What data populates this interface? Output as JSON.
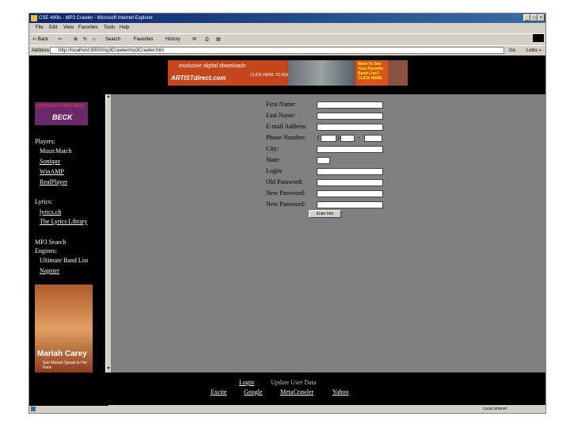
{
  "window": {
    "title": "CSE 490ls - MP3 Crawler - Microsoft Internet Explorer",
    "controls": [
      "_",
      "□",
      "×"
    ]
  },
  "menu": [
    "File",
    "Edit",
    "View",
    "Favorites",
    "Tools",
    "Help"
  ],
  "toolbar": {
    "back": "⇦ Back",
    "forward": "⇨",
    "search": "Search",
    "favorites": "Favorites",
    "history": "History"
  },
  "address": {
    "label": "Address",
    "url": "http://localhost:8000/mp3Crawler/mp3Crawler.htm",
    "go": "Go",
    "links": "Links »"
  },
  "banner": {
    "tagline": "exclusive digital downloads",
    "brand": "ARTISTdirect.com",
    "click": "CLICK HERE TO ROCK",
    "promo": "Want To See Your Favorite Band Live? CLICK HERE"
  },
  "sidebar": {
    "ad_header": "ENTANGLED FANS WEEK",
    "ad_title": "BECK",
    "players_heading": "Players:",
    "players": [
      "MusicMatch",
      "Sonique",
      "WinAMP",
      "RealPlayer"
    ],
    "lyrics_heading": "Lyrics:",
    "lyrics": [
      "lyrics.ch",
      "The Lyrics Library"
    ],
    "search_heading_1": "MP3 Search",
    "search_heading_2": "Engines:",
    "engines": [
      "Ultimate Band List",
      "Napster"
    ],
    "ad2_name": "Mariah Carey",
    "ad2_sub": "See Mariah Speak to Her Fans"
  },
  "form": {
    "first_name": "First Name:",
    "last_name": "Last Name:",
    "email": "E-mail Address:",
    "phone": "Phone Number:",
    "phone_open": "(",
    "phone_close": ")",
    "phone_dash": "-",
    "city": "City:",
    "state": "State:",
    "login": "Login:",
    "old_password": "Old Password:",
    "new_password": "New Password:",
    "new_password2": "New Password:",
    "submit": "Enter Info"
  },
  "footer": {
    "row1": [
      "Login",
      "Update User Data"
    ],
    "row2": [
      "Excite",
      "Google",
      "MetaCrawler",
      "Yahoo"
    ]
  },
  "status": {
    "zone": "Local intranet"
  },
  "colors": {
    "title_bar": "#0a246a",
    "page_bg": "#000000",
    "form_bg": "#808080",
    "chrome": "#d4d0c8"
  }
}
